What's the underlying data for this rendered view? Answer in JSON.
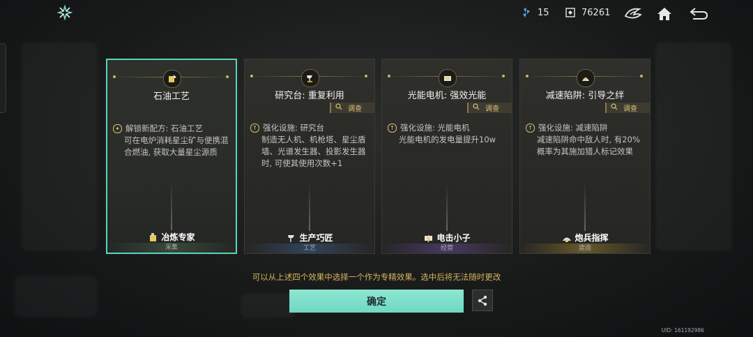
{
  "topbar": {
    "resource_a": "15",
    "resource_b": "76261",
    "icons": [
      "shuriken-logo-icon",
      "crystal-icon",
      "currency-icon",
      "faction-emblem-icon",
      "home-icon",
      "back-arrow-icon"
    ]
  },
  "cards": [
    {
      "title": "石油工艺",
      "selected": true,
      "investigate": "",
      "bullet_icon": "unlock-icon",
      "desc_head": "解锁新配方: 石油工艺",
      "desc_body": "可在电炉消耗星尘矿与便携混合燃油, 获取大量星尘源质",
      "trait": "冶炼专家",
      "category": "采集",
      "emblem_icon": "oil-recipe-icon"
    },
    {
      "title": "研究台: 重复利用",
      "selected": false,
      "investigate": "调查",
      "bullet_icon": "upgrade-icon",
      "desc_head": "强化设施: 研究台",
      "desc_body": "制造无人机、机枪塔、星尘盾墙、光谱发生器、投影发生器时, 可使其使用次数+1",
      "trait": "生产巧匠",
      "category": "工艺",
      "emblem_icon": "research-bench-icon"
    },
    {
      "title": "光能电机: 强效光能",
      "selected": false,
      "investigate": "调查",
      "bullet_icon": "upgrade-icon",
      "desc_head": "强化设施: 光能电机",
      "desc_body": "光能电机的发电量提升10w",
      "trait": "电击小子",
      "category": "经营",
      "emblem_icon": "solar-motor-icon"
    },
    {
      "title": "减速陷阱: 引导之绊",
      "selected": false,
      "investigate": "调查",
      "bullet_icon": "upgrade-icon",
      "desc_head": "强化设施: 减速陷阱",
      "desc_body": "减速陷阱命中敌人时, 有20%概率为其施加猎人标记效果",
      "trait": "炮兵指挥",
      "category": "建造",
      "emblem_icon": "slow-trap-icon"
    }
  ],
  "notice": "可以从上述四个效果中选择一个作为专精效果。选中后将无法随时更改",
  "confirm_label": "确定",
  "uid": "UID: 161192986",
  "colors": {
    "accent": "#6fd8c2",
    "gold": "#d4b45c",
    "selected_border": "#57d6bd"
  }
}
